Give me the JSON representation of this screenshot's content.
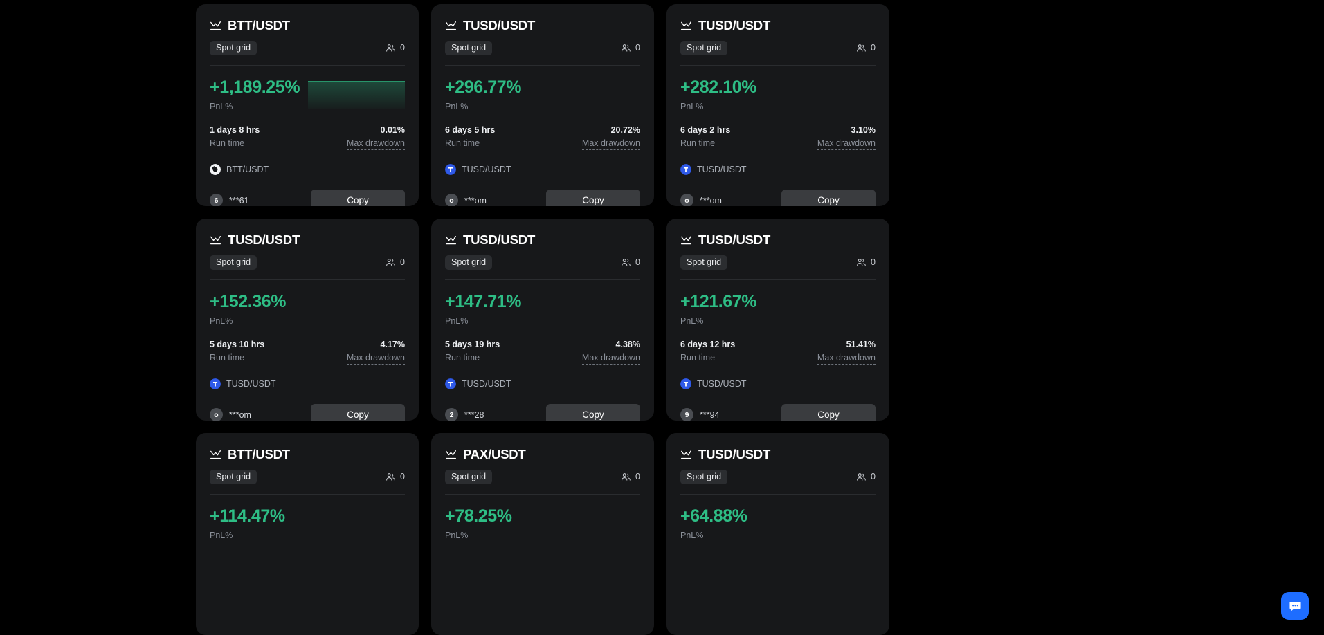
{
  "theme": {
    "background": "#000000",
    "card_bg": "#17181a",
    "positive": "#2ebd85",
    "muted": "#8b9099",
    "button_bg": "#3a3c3f",
    "accent": "#1e6dff",
    "tag_bg": "#2b2d30"
  },
  "labels": {
    "pnl_label": "PnL%",
    "runtime_label": "Run time",
    "drawdown_label": "Max drawdown",
    "copy_label": "Copy",
    "strategy_tag": "Spot grid"
  },
  "icons": {
    "pair": "line-chart-icon",
    "followers": "people-icon",
    "chat": "chat-bubble-icon"
  },
  "cards": [
    {
      "pair": "BTT/USDT",
      "tag": "Spot grid",
      "followers": "0",
      "pnl": "+1,189.25%",
      "runtime": "1 days 8 hrs",
      "drawdown": "0.01%",
      "asset": "BTT/USDT",
      "asset_icon": "btt-icon",
      "trader_initial": "6",
      "trader_name": "***61",
      "has_chart": true,
      "chart": {
        "type": "area",
        "values": [
          100,
          100,
          100,
          100,
          100,
          100,
          100,
          100
        ],
        "color": "#2ebd85"
      }
    },
    {
      "pair": "TUSD/USDT",
      "tag": "Spot grid",
      "followers": "0",
      "pnl": "+296.77%",
      "runtime": "6 days 5 hrs",
      "drawdown": "20.72%",
      "asset": "TUSD/USDT",
      "asset_icon": "tusd-icon",
      "trader_initial": "o",
      "trader_name": "***om",
      "has_chart": false
    },
    {
      "pair": "TUSD/USDT",
      "tag": "Spot grid",
      "followers": "0",
      "pnl": "+282.10%",
      "runtime": "6 days 2 hrs",
      "drawdown": "3.10%",
      "asset": "TUSD/USDT",
      "asset_icon": "tusd-icon",
      "trader_initial": "o",
      "trader_name": "***om",
      "has_chart": false
    },
    {
      "pair": "TUSD/USDT",
      "tag": "Spot grid",
      "followers": "0",
      "pnl": "+152.36%",
      "runtime": "5 days 10 hrs",
      "drawdown": "4.17%",
      "asset": "TUSD/USDT",
      "asset_icon": "tusd-icon",
      "trader_initial": "o",
      "trader_name": "***om",
      "has_chart": false
    },
    {
      "pair": "TUSD/USDT",
      "tag": "Spot grid",
      "followers": "0",
      "pnl": "+147.71%",
      "runtime": "5 days 19 hrs",
      "drawdown": "4.38%",
      "asset": "TUSD/USDT",
      "asset_icon": "tusd-icon",
      "trader_initial": "2",
      "trader_name": "***28",
      "has_chart": false
    },
    {
      "pair": "TUSD/USDT",
      "tag": "Spot grid",
      "followers": "0",
      "pnl": "+121.67%",
      "runtime": "6 days 12 hrs",
      "drawdown": "51.41%",
      "asset": "TUSD/USDT",
      "asset_icon": "tusd-icon",
      "trader_initial": "9",
      "trader_name": "***94",
      "has_chart": false
    },
    {
      "pair": "BTT/USDT",
      "tag": "Spot grid",
      "followers": "0",
      "pnl": "+114.47%",
      "runtime": "",
      "drawdown": "",
      "asset": "",
      "asset_icon": "btt-icon",
      "trader_initial": "",
      "trader_name": "",
      "has_chart": false
    },
    {
      "pair": "PAX/USDT",
      "tag": "Spot grid",
      "followers": "0",
      "pnl": "+78.25%",
      "runtime": "",
      "drawdown": "",
      "asset": "",
      "asset_icon": "pax-icon",
      "trader_initial": "",
      "trader_name": "",
      "has_chart": false
    },
    {
      "pair": "TUSD/USDT",
      "tag": "Spot grid",
      "followers": "0",
      "pnl": "+64.88%",
      "runtime": "",
      "drawdown": "",
      "asset": "",
      "asset_icon": "tusd-icon",
      "trader_initial": "",
      "trader_name": "",
      "has_chart": false
    }
  ]
}
